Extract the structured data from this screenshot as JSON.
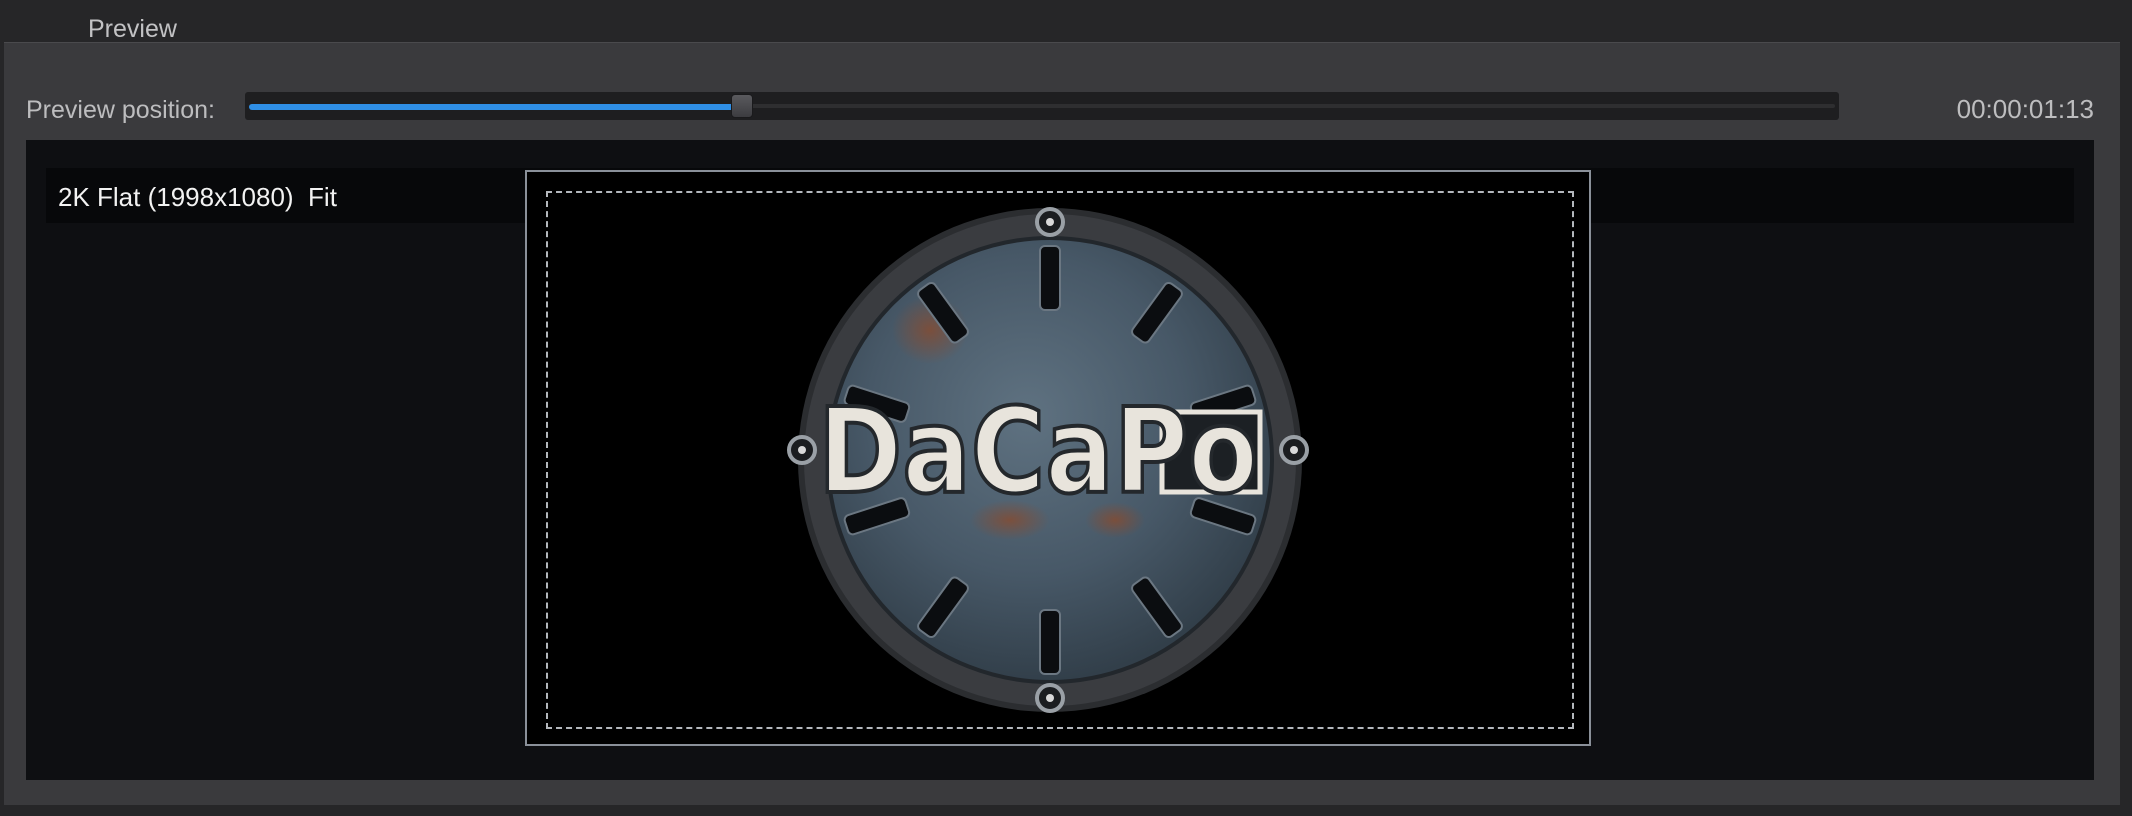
{
  "header": {
    "tab_label": "Preview"
  },
  "preview": {
    "position_label": "Preview position:",
    "position_fraction": 0.31,
    "timecode": "00:00:01:13",
    "format_name": "2K Flat (1998x1080)",
    "zoom_mode": "Fit",
    "logo_text": "DaCaPo"
  },
  "colors": {
    "accent": "#2f8fe6",
    "panel_bg": "#3a3a3d",
    "viewport_bg": "#0e0f12"
  }
}
